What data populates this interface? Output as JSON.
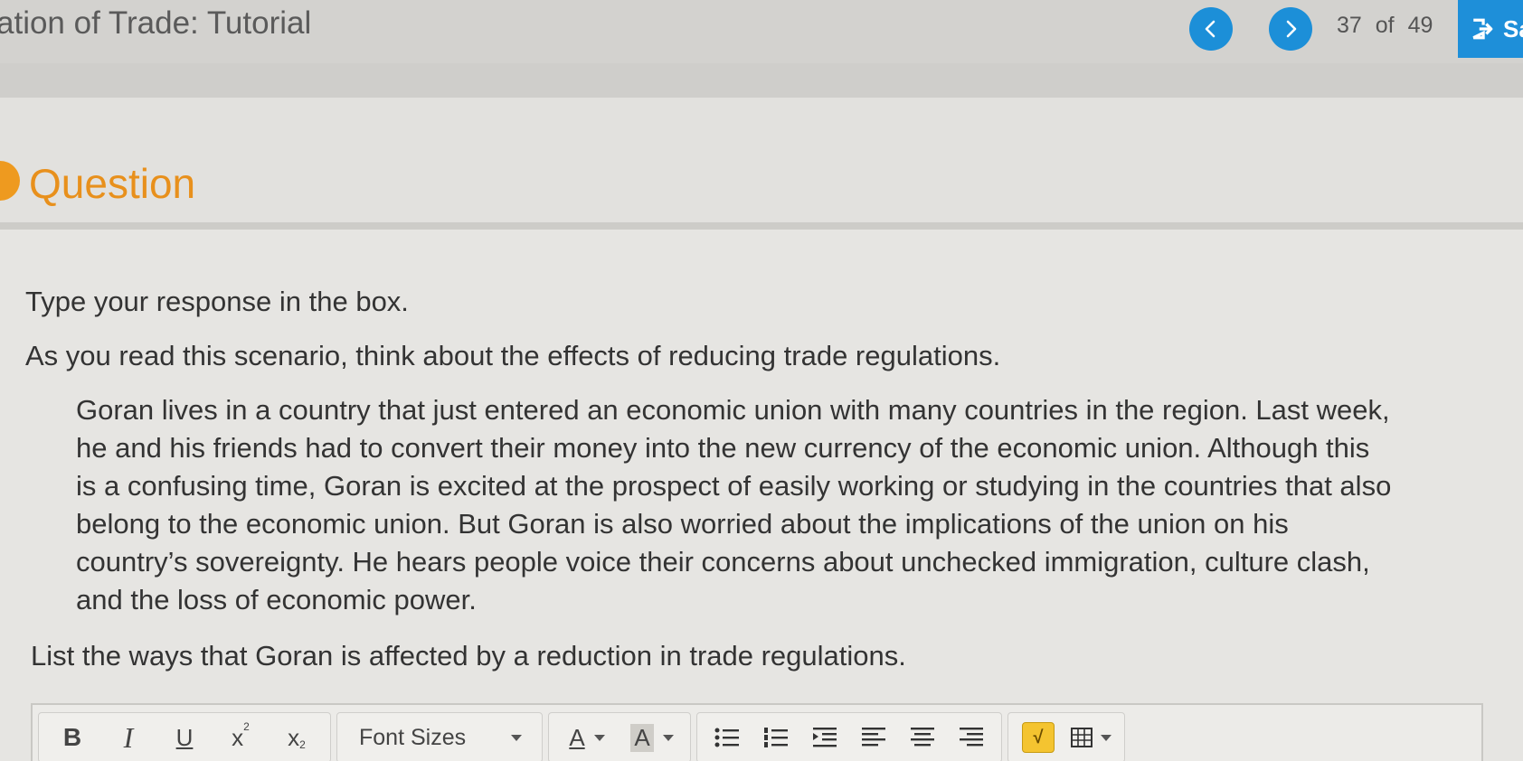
{
  "header": {
    "title": "ation of Trade: Tutorial",
    "counter_current": "37",
    "counter_of": "of",
    "counter_total": "49",
    "save_label": "Sa"
  },
  "question": {
    "heading": "Question",
    "instruction": "Type your response in the box.",
    "prompt": "As you read this scenario, think about the effects of reducing trade regulations.",
    "scenario_lines": [
      "Goran lives in a country that just entered an economic union with many countries in the region. Last week,",
      "he and his friends had to convert their money into the new currency of the economic union. Although this",
      "is a confusing time, Goran is excited at the prospect of easily working or studying in the countries that also",
      "belong to the economic union. But Goran is also worried about the implications of the union on his",
      "country’s sovereignty. He hears people voice their concerns about unchecked immigration, culture clash,",
      "and the loss of economic power."
    ],
    "task": "List the ways that Goran is affected by a reduction in trade regulations."
  },
  "toolbar": {
    "bold": "B",
    "italic": "I",
    "underline": "U",
    "superscript": "x",
    "superscript_mark": "2",
    "subscript": "x",
    "subscript_mark": "2",
    "font_sizes": "Font Sizes",
    "font_color": "A",
    "highlight_color": "A",
    "math_label": "√"
  },
  "colors": {
    "accent_blue": "#1c8fd8",
    "question_orange": "#e8901c"
  }
}
